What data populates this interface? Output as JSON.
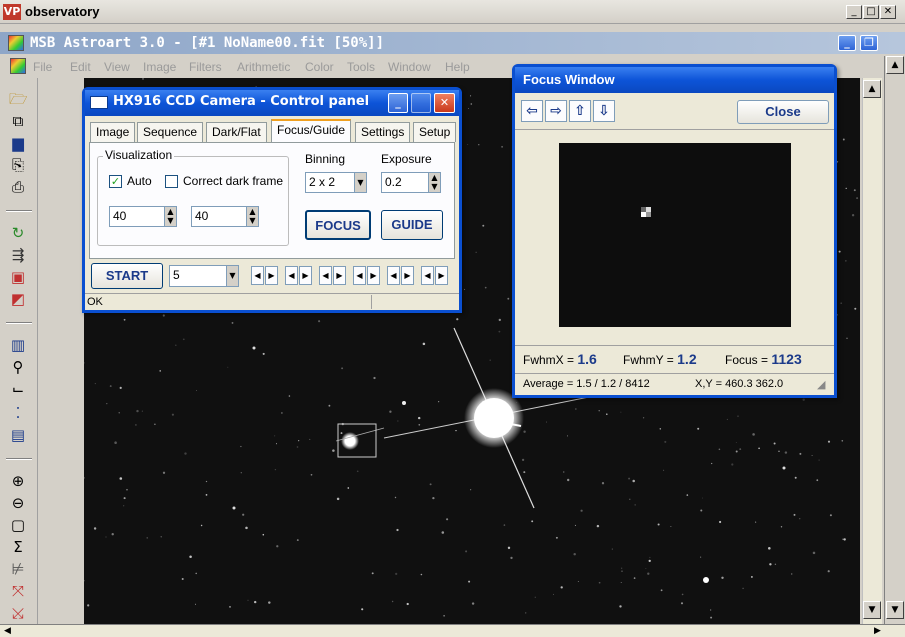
{
  "outer_window": {
    "title": "observatory",
    "icon_text": "VP"
  },
  "mdi_window": {
    "title": "MSB Astroart 3.0 - [#1 NoName00.fit [50%]]"
  },
  "menu": [
    "File",
    "Edit",
    "View",
    "Image",
    "Filters",
    "Arithmetic",
    "Color",
    "Tools",
    "Window",
    "Help"
  ],
  "toolbar_icons": [
    "open-icon",
    "copy-icon",
    "save-icon",
    "paste-icon",
    "print-icon",
    "refresh-icon",
    "align-icon",
    "layers-icon",
    "rgb-icon",
    "histogram-icon",
    "zoom-icon",
    "curve-icon",
    "points-icon",
    "document-icon",
    "zoom-in-icon",
    "zoom-out-icon",
    "fit-icon",
    "sum-icon",
    "flip-icon",
    "expand-icon",
    "shrink-icon"
  ],
  "control_panel": {
    "title": "HX916 CCD Camera - Control panel",
    "tabs": [
      "Image",
      "Sequence",
      "Dark/Flat",
      "Focus/Guide",
      "Settings",
      "Setup"
    ],
    "active_tab": "Focus/Guide",
    "visualization_label": "Visualization",
    "auto_label": "Auto",
    "auto_checked": true,
    "correct_dark_label": "Correct dark frame",
    "correct_dark_checked": false,
    "vis_low": "40",
    "vis_high": "40",
    "binning_label": "Binning",
    "binning_value": "2 x 2",
    "exposure_label": "Exposure",
    "exposure_value": "0.2",
    "focus_button": "FOCUS",
    "guide_button": "GUIDE",
    "start_button": "START",
    "count_value": "5",
    "status_text": "OK"
  },
  "focus_window": {
    "title": "Focus Window",
    "close_button": "Close",
    "fwhmx_label": "FwhmX =",
    "fwhmx_value": "1.6",
    "fwhmy_label": "FwhmY =",
    "fwhmy_value": "1.2",
    "focus_label": "Focus =",
    "focus_value": "1123",
    "average_text": "Average = 1.5 / 1.2 / 8412",
    "xy_text": "X,Y = 460.3  362.0"
  },
  "colors": {
    "title_blue": "#0a4fd0",
    "field_bg": "#101010"
  }
}
